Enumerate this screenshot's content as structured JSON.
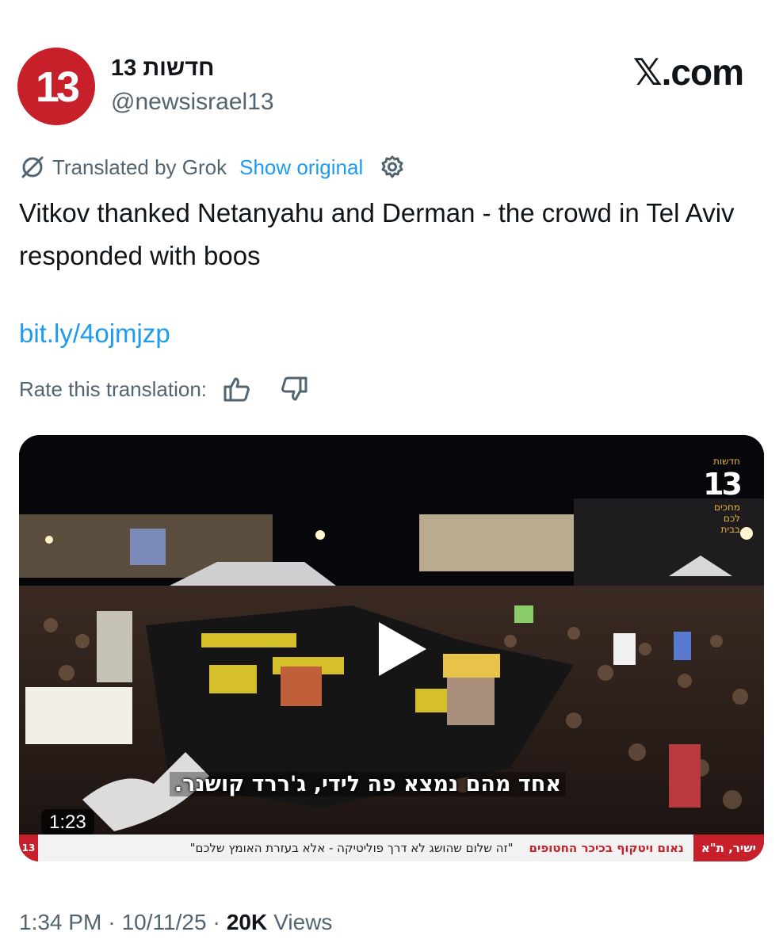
{
  "author": {
    "display_name": "חדשות 13",
    "handle": "@newsisrael13",
    "avatar_text": "13",
    "avatar_color": "#c8202a"
  },
  "site": {
    "logo_text": "𝕏.com"
  },
  "translation": {
    "label": "Translated by Grok",
    "show_original": "Show original",
    "icon": "translate-slash-icon",
    "settings_icon": "gear-icon"
  },
  "tweet": {
    "text": "Vitkov thanked Netanyahu and Derman - the crowd in Tel Aviv responded with boos",
    "link": "bit.ly/4ojmjzp"
  },
  "rating": {
    "label": "Rate this translation:",
    "icons": [
      "thumbs-up-icon",
      "thumbs-down-icon"
    ]
  },
  "video": {
    "duration": "1:23",
    "subtitle": "אחד מהם נמצא פה לידי, ג'ררד קושנר.",
    "ticker_live": "ישיר, ת\"א",
    "ticker_headline": "נאום ויטקוף בכיכר החטופים",
    "ticker_quote": "\"זה שלום שהושג לא דרך פוליטיקה - אלא בעזרת האומץ שלכם\"",
    "ticker_logo": "13",
    "bug_logo": "13",
    "bug_lines": [
      "חדשות",
      "מחכים",
      "לכם",
      "בבית"
    ]
  },
  "meta": {
    "time": "1:34 PM",
    "date": "10/11/25",
    "views_count": "20K",
    "views_label": "Views"
  },
  "colors": {
    "link_blue": "#1d9bf0",
    "secondary_gray": "#536471",
    "text_black": "#0f1419"
  }
}
